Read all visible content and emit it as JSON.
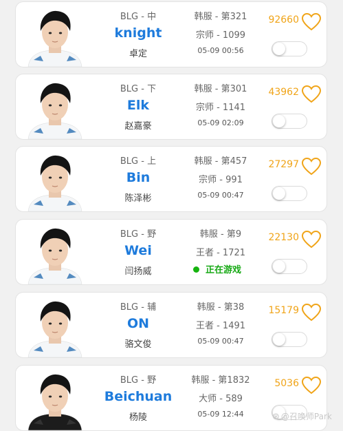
{
  "players": [
    {
      "team_role": "BLG - 中",
      "ign": "knight",
      "real_name": "卓定",
      "server": "韩服 - 第321",
      "rank": "宗师 - 1099",
      "time": "05-09 00:56",
      "in_game": false,
      "likes": "92660",
      "shirt": "light"
    },
    {
      "team_role": "BLG - 下",
      "ign": "Elk",
      "real_name": "赵嘉豪",
      "server": "韩服 - 第301",
      "rank": "宗师 - 1141",
      "time": "05-09 02:09",
      "in_game": false,
      "likes": "43962",
      "shirt": "light"
    },
    {
      "team_role": "BLG - 上",
      "ign": "Bin",
      "real_name": "陈泽彬",
      "server": "韩服 - 第457",
      "rank": "宗师 - 991",
      "time": "05-09 00:47",
      "in_game": false,
      "likes": "27297",
      "shirt": "light"
    },
    {
      "team_role": "BLG - 野",
      "ign": "Wei",
      "real_name": "闫扬威",
      "server": "韩服 - 第9",
      "rank": "王者 - 1721",
      "time": "正在游戏",
      "in_game": true,
      "likes": "22130",
      "shirt": "light"
    },
    {
      "team_role": "BLG - 辅",
      "ign": "ON",
      "real_name": "骆文俊",
      "server": "韩服 - 第38",
      "rank": "王者 - 1491",
      "time": "05-09 00:47",
      "in_game": false,
      "likes": "15179",
      "shirt": "light"
    },
    {
      "team_role": "BLG - 野",
      "ign": "Beichuan",
      "real_name": "杨陵",
      "server": "韩服 - 第1832",
      "rank": "大师 - 589",
      "time": "05-09 12:44",
      "in_game": false,
      "likes": "5036",
      "shirt": "dark"
    }
  ],
  "watermark": "@召唤师Park",
  "colors": {
    "accent_blue": "#1e7bdc",
    "like_orange": "#f0a418",
    "in_game_green": "#17a915"
  }
}
